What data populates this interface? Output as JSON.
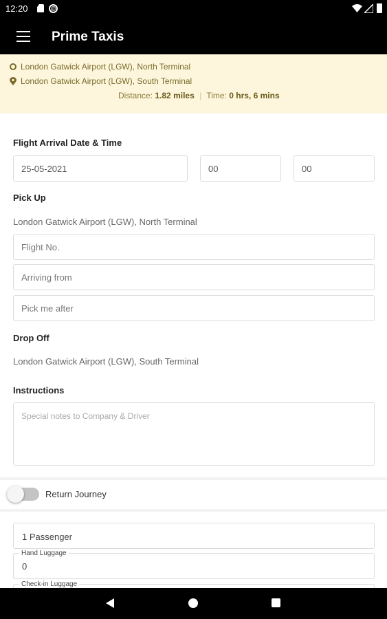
{
  "status_bar": {
    "time": "12:20",
    "circle_glyph": "@"
  },
  "app_bar": {
    "title": "Prime Taxis"
  },
  "route": {
    "pickup": "London Gatwick Airport (LGW), North Terminal",
    "dropoff": "London Gatwick Airport (LGW), South Terminal",
    "distance_label": "Distance:",
    "distance_value": "1.82 miles",
    "time_label": "Time:",
    "time_value": "0 hrs, 6 mins",
    "separator": "|"
  },
  "flight": {
    "heading": "Flight Arrival Date & Time",
    "date": "25-05-2021",
    "hour": "00",
    "minute": "00"
  },
  "pickup": {
    "heading": "Pick Up",
    "address": "London Gatwick Airport (LGW), North Terminal",
    "flight_no_placeholder": "Flight No.",
    "arriving_from_placeholder": "Arriving from",
    "pick_me_after_placeholder": "Pick me after"
  },
  "dropoff": {
    "heading": "Drop Off",
    "address": "London Gatwick Airport (LGW), South Terminal"
  },
  "instructions": {
    "heading": "Instructions",
    "placeholder": "Special notes to Company & Driver"
  },
  "return_journey": {
    "label": "Return Journey",
    "enabled": false
  },
  "passengers": {
    "value": "1 Passenger"
  },
  "hand_luggage": {
    "label": "Hand Luggage",
    "value": "0"
  },
  "checkin_luggage": {
    "label": "Check-in Luggage"
  },
  "colors": {
    "app_bar": "#000000",
    "route_panel": "#fdf6dc",
    "route_text": "#7a6a2a"
  }
}
